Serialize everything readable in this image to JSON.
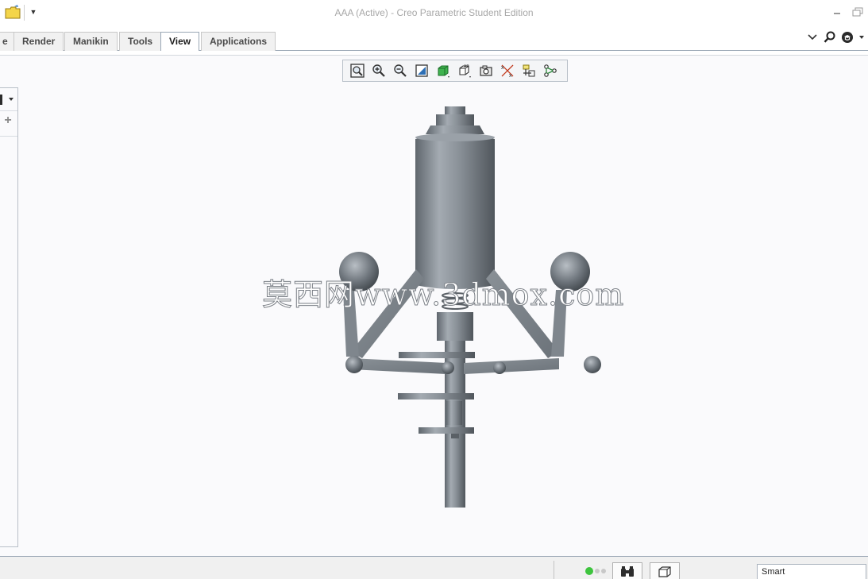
{
  "window": {
    "title": "AAA (Active) - Creo Parametric Student Edition"
  },
  "quick_access": {
    "icons": [
      "open-folder-icon",
      "customize-dropdown-icon"
    ]
  },
  "ribbon": {
    "tabs": [
      {
        "label": "e",
        "active": false
      },
      {
        "label": "Render",
        "active": false
      },
      {
        "label": "Manikin",
        "active": false
      },
      {
        "label": "Tools",
        "active": false
      },
      {
        "label": "View",
        "active": true
      },
      {
        "label": "Applications",
        "active": false
      }
    ],
    "right_icons": [
      "collapse-ribbon-icon",
      "search-icon",
      "help-icon"
    ]
  },
  "graphics_toolbar": {
    "buttons": [
      "refit-icon",
      "zoom-in-icon",
      "zoom-out-icon",
      "repaint-icon",
      "display-style-icon",
      "saved-orientations-icon",
      "view-manager-icon",
      "perspective-icon",
      "datum-display-icon",
      "spin-center-icon"
    ]
  },
  "viewport": {
    "watermark": "莫西网www.3dmox.com"
  },
  "status_bar": {
    "filter_value": "Smart",
    "icons": [
      "regen-status-icon",
      "find-icon",
      "selected-items-icon"
    ]
  },
  "colors": {
    "accent": "#9aa7b5",
    "model_gray": "#7d848c",
    "status_green": "#3ec43e",
    "folder_yellow": "#f4d54a"
  }
}
